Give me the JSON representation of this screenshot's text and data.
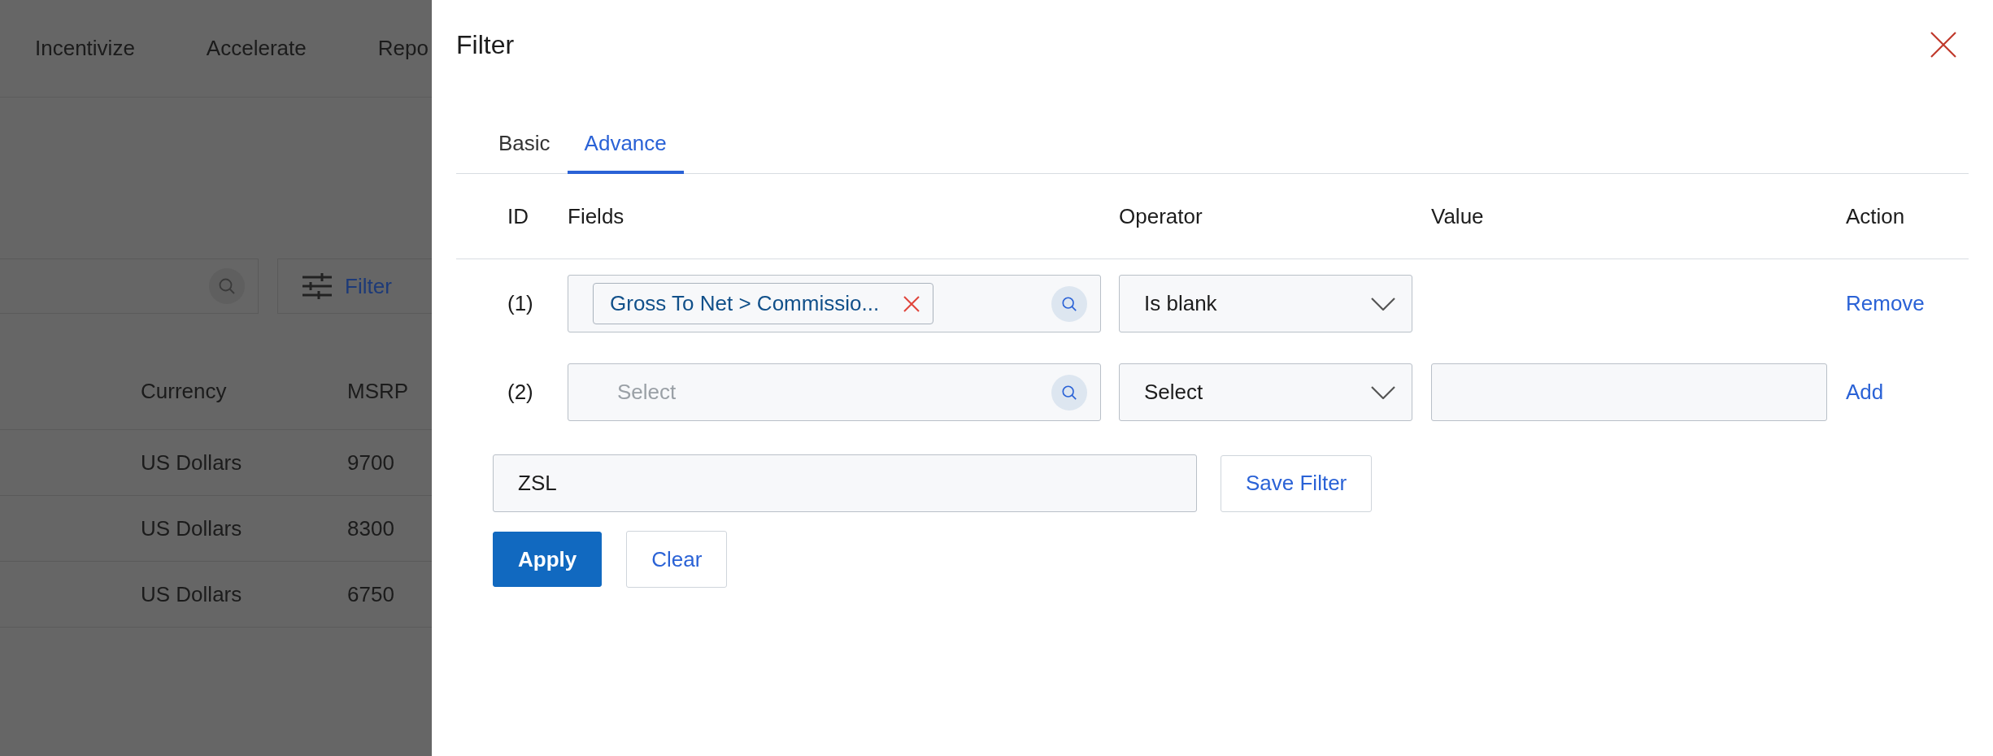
{
  "background": {
    "nav": [
      "Incentivize",
      "Accelerate",
      "Repo"
    ],
    "filter_button": "Filter",
    "table": {
      "columns": [
        "Currency",
        "MSRP"
      ],
      "rows": [
        [
          "US Dollars",
          "9700"
        ],
        [
          "US Dollars",
          "8300"
        ],
        [
          "US Dollars",
          "6750"
        ]
      ]
    }
  },
  "filter_panel": {
    "title": "Filter",
    "tabs": [
      {
        "label": "Basic",
        "selected": false
      },
      {
        "label": "Advance",
        "selected": true
      }
    ],
    "columns": [
      "ID",
      "Fields",
      "Operator",
      "Value",
      "Action"
    ],
    "rows": [
      {
        "id": "(1)",
        "field": {
          "tag": "Gross To Net > Commissio..."
        },
        "operator": "Is blank",
        "value_input": false,
        "action": "Remove"
      },
      {
        "id": "(2)",
        "field": {
          "placeholder": "Select"
        },
        "operator": "Select",
        "value_input": true,
        "action": "Add"
      }
    ],
    "filter_name": "ZSL",
    "save_button": "Save Filter",
    "apply_button": "Apply",
    "clear_button": "Clear"
  }
}
